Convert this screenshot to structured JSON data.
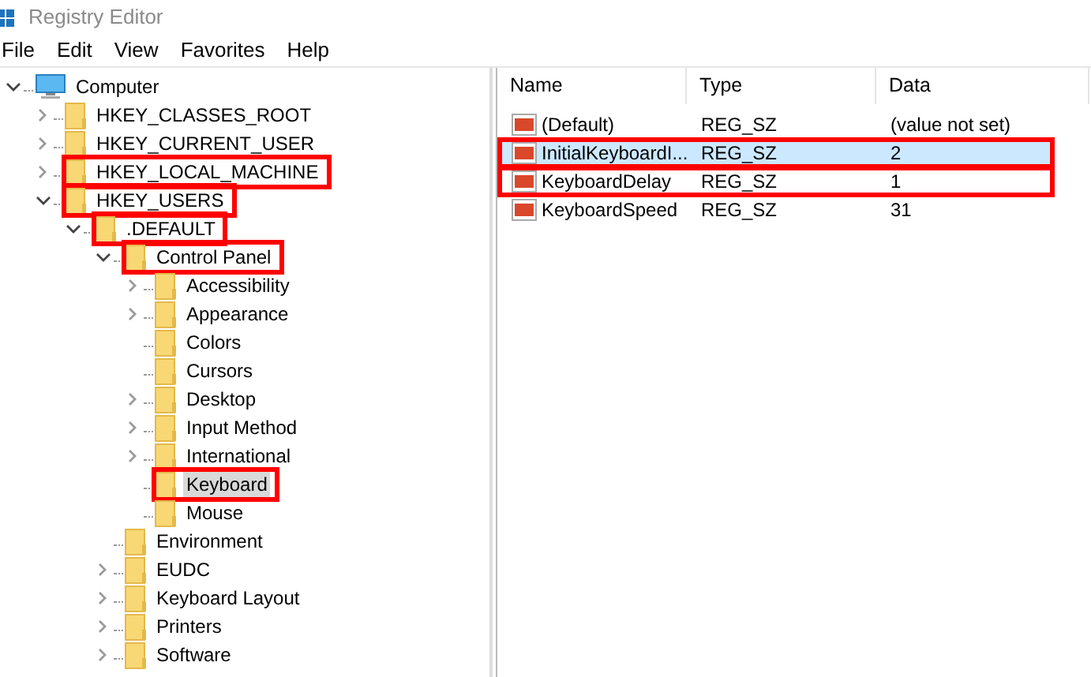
{
  "window": {
    "title": "Registry Editor"
  },
  "menu": [
    "File",
    "Edit",
    "View",
    "Favorites",
    "Help"
  ],
  "tree": [
    {
      "label": "Computer",
      "kind": "computer",
      "has_children": true,
      "expanded": true,
      "selected": false,
      "highlighted": false,
      "children": [
        {
          "label": "HKEY_CLASSES_ROOT",
          "kind": "folder",
          "has_children": true,
          "expanded": false,
          "selected": false,
          "highlighted": false
        },
        {
          "label": "HKEY_CURRENT_USER",
          "kind": "folder",
          "has_children": true,
          "expanded": false,
          "selected": false,
          "highlighted": false
        },
        {
          "label": "HKEY_LOCAL_MACHINE",
          "kind": "folder",
          "has_children": true,
          "expanded": false,
          "selected": false,
          "highlighted": true
        },
        {
          "label": "HKEY_USERS",
          "kind": "folder",
          "has_children": true,
          "expanded": true,
          "selected": false,
          "highlighted": true,
          "children": [
            {
              "label": ".DEFAULT",
              "kind": "folder",
              "has_children": true,
              "expanded": true,
              "selected": false,
              "highlighted": true,
              "children": [
                {
                  "label": "Control Panel",
                  "kind": "folder",
                  "has_children": true,
                  "expanded": true,
                  "selected": false,
                  "highlighted": true,
                  "children": [
                    {
                      "label": "Accessibility",
                      "kind": "folder",
                      "has_children": true,
                      "expanded": false,
                      "selected": false,
                      "highlighted": false
                    },
                    {
                      "label": "Appearance",
                      "kind": "folder",
                      "has_children": true,
                      "expanded": false,
                      "selected": false,
                      "highlighted": false
                    },
                    {
                      "label": "Colors",
                      "kind": "folder",
                      "has_children": false,
                      "expanded": false,
                      "selected": false,
                      "highlighted": false
                    },
                    {
                      "label": "Cursors",
                      "kind": "folder",
                      "has_children": false,
                      "expanded": false,
                      "selected": false,
                      "highlighted": false
                    },
                    {
                      "label": "Desktop",
                      "kind": "folder",
                      "has_children": true,
                      "expanded": false,
                      "selected": false,
                      "highlighted": false
                    },
                    {
                      "label": "Input Method",
                      "kind": "folder",
                      "has_children": true,
                      "expanded": false,
                      "selected": false,
                      "highlighted": false
                    },
                    {
                      "label": "International",
                      "kind": "folder",
                      "has_children": true,
                      "expanded": false,
                      "selected": false,
                      "highlighted": false
                    },
                    {
                      "label": "Keyboard",
                      "kind": "folder",
                      "has_children": false,
                      "expanded": false,
                      "selected": true,
                      "highlighted": true
                    },
                    {
                      "label": "Mouse",
                      "kind": "folder",
                      "has_children": false,
                      "expanded": false,
                      "selected": false,
                      "highlighted": false
                    }
                  ]
                },
                {
                  "label": "Environment",
                  "kind": "folder",
                  "has_children": false,
                  "expanded": false,
                  "selected": false,
                  "highlighted": false
                },
                {
                  "label": "EUDC",
                  "kind": "folder",
                  "has_children": true,
                  "expanded": false,
                  "selected": false,
                  "highlighted": false
                },
                {
                  "label": "Keyboard Layout",
                  "kind": "folder",
                  "has_children": true,
                  "expanded": false,
                  "selected": false,
                  "highlighted": false
                },
                {
                  "label": "Printers",
                  "kind": "folder",
                  "has_children": true,
                  "expanded": false,
                  "selected": false,
                  "highlighted": false
                },
                {
                  "label": "Software",
                  "kind": "folder",
                  "has_children": true,
                  "expanded": false,
                  "selected": false,
                  "highlighted": false
                }
              ]
            }
          ]
        }
      ]
    }
  ],
  "values": {
    "columns": [
      "Name",
      "Type",
      "Data"
    ],
    "rows": [
      {
        "name": "(Default)",
        "type": "REG_SZ",
        "data": "(value not set)",
        "selected": false,
        "highlighted": false
      },
      {
        "name": "InitialKeyboardI...",
        "type": "REG_SZ",
        "data": "2",
        "selected": true,
        "highlighted": true
      },
      {
        "name": "KeyboardDelay",
        "type": "REG_SZ",
        "data": "1",
        "selected": false,
        "highlighted": true
      },
      {
        "name": "KeyboardSpeed",
        "type": "REG_SZ",
        "data": "31",
        "selected": false,
        "highlighted": false
      }
    ]
  }
}
